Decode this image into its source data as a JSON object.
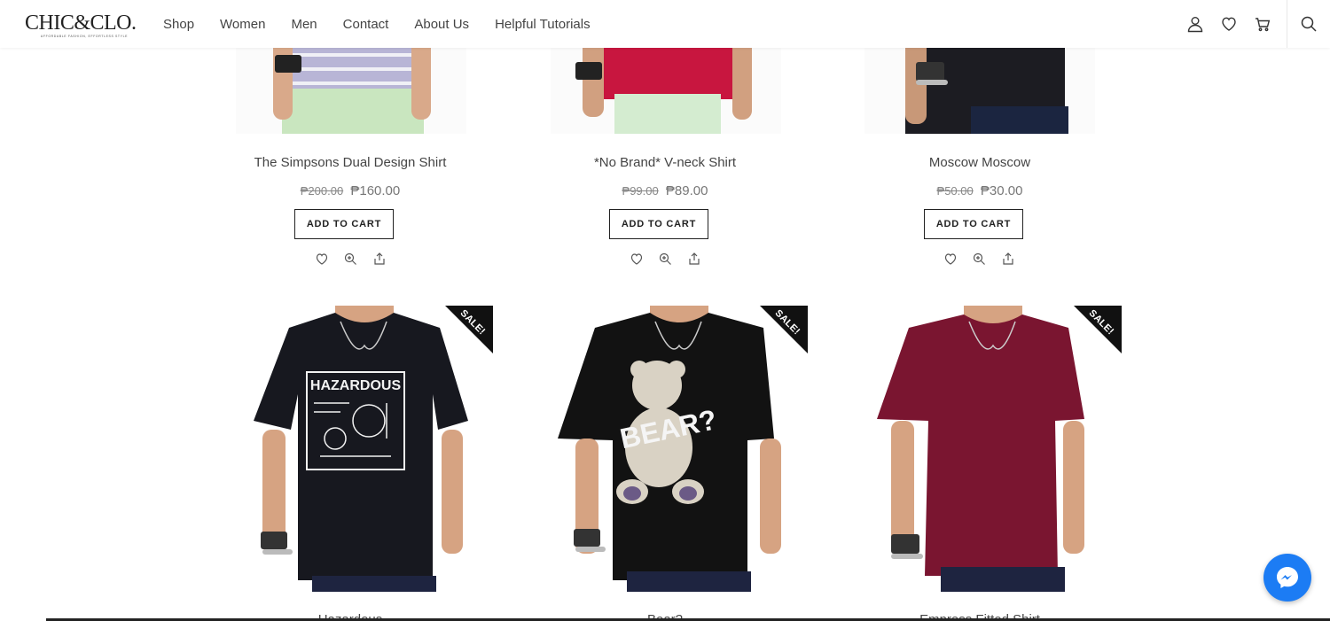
{
  "brand": {
    "logo_text": "CHIC&CLO.",
    "logo_tagline": "AFFORDABLE FASHION, EFFORTLESS STYLE"
  },
  "nav": {
    "items": [
      {
        "label": "Shop"
      },
      {
        "label": "Women"
      },
      {
        "label": "Men"
      },
      {
        "label": "Contact"
      },
      {
        "label": "About Us"
      },
      {
        "label": "Helpful Tutorials"
      }
    ]
  },
  "header_icons": [
    "user-icon",
    "heart-icon",
    "cart-icon",
    "search-icon"
  ],
  "products_top": [
    {
      "title": "The Simpsons Dual Design Shirt",
      "old_price": "₱200.00",
      "new_price": "₱160.00",
      "button": "ADD TO CART",
      "shirt_color": "#b8b5d6",
      "shorts_color": "#c9e6bf"
    },
    {
      "title": "*No Brand* V-neck Shirt",
      "old_price": "₱99.00",
      "new_price": "₱89.00",
      "button": "ADD TO CART",
      "shirt_color": "#c8163f",
      "shorts_color": "#d4ecd0"
    },
    {
      "title": "Moscow Moscow",
      "old_price": "₱50.00",
      "new_price": "₱30.00",
      "button": "ADD TO CART",
      "shirt_color": "#1c1c22",
      "shorts_color": "#1b2540"
    }
  ],
  "products_bottom": [
    {
      "title": "Hazardous",
      "badge": "SALE!",
      "shirt_color": "#17181f",
      "graphic_text": "HAZARDOUS"
    },
    {
      "title": "Bear?",
      "badge": "SALE!",
      "shirt_color": "#121212",
      "graphic_text": "BEAR?"
    },
    {
      "title": "Empress Fitted Shirt",
      "badge": "SALE!",
      "shirt_color": "#7a1530",
      "graphic_text": ""
    }
  ],
  "colors": {
    "accent": "#222222",
    "messenger": "#1c7cf4",
    "sale_badge": "#111111"
  }
}
